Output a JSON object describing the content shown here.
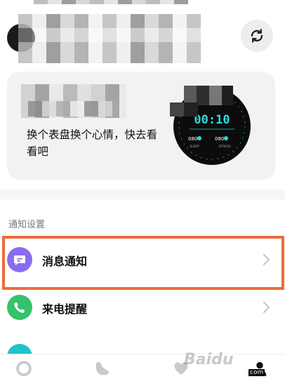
{
  "header": {
    "sync_icon": "sync-icon"
  },
  "promo": {
    "text": "换个表盘换个心情，快去看看吧",
    "watch": {
      "time": "00:10",
      "stat_left": "080",
      "stat_right": "080",
      "label_left": "SLEEP",
      "label_right": "STRESS"
    }
  },
  "notifications": {
    "section_title": "通知设置",
    "items": [
      {
        "label": "消息通知",
        "icon": "message-icon",
        "color": "#8b6cf0"
      },
      {
        "label": "来电提醒",
        "icon": "phone-icon",
        "color": "#34c26a"
      },
      {
        "label": "",
        "icon": "alarm-icon",
        "color": "#1fc2c9"
      }
    ]
  },
  "bottom_nav": {
    "items": [
      {
        "icon": "ring-icon"
      },
      {
        "icon": "shoe-icon"
      },
      {
        "icon": "heart-icon"
      },
      {
        "icon": "person-icon"
      }
    ]
  },
  "watermark": {
    "text": "Baidu",
    "sub": "com"
  },
  "colors": {
    "highlight": "#ee6a3c",
    "card_bg": "#f2f2f2"
  }
}
